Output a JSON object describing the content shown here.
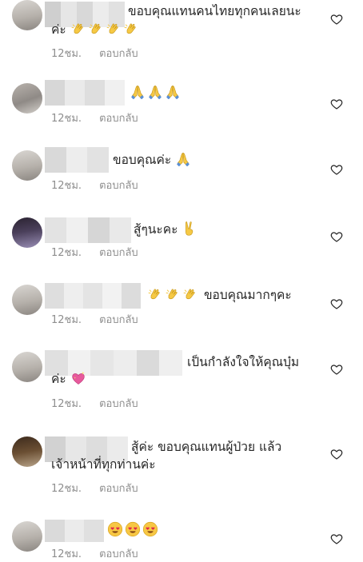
{
  "comments": [
    {
      "text_lines": [
        "ขอบคุณแทนคนไทยทุกคนเลยนะ",
        "ค่ะ"
      ],
      "emoji": "clapping-hands",
      "emoji_count": 4,
      "time": "12ชม.",
      "reply": "ตอบกลับ"
    },
    {
      "text_lines": [
        ""
      ],
      "emoji": "folded-hands",
      "emoji_count": 3,
      "time": "12ชม.",
      "reply": "ตอบกลับ"
    },
    {
      "text_lines": [
        "ขอบคุณค่ะ"
      ],
      "emoji": "folded-hands",
      "emoji_count": 1,
      "time": "12ชม.",
      "reply": "ตอบกลับ"
    },
    {
      "text_lines": [
        "สู้ๆนะคะ"
      ],
      "emoji": "victory-hand",
      "emoji_count": 1,
      "time": "12ชม.",
      "reply": "ตอบกลับ"
    },
    {
      "text_lines": [
        "ขอบคุณมากๆคะ"
      ],
      "emoji": "clapping-hands",
      "emoji_count": 3,
      "time": "12ชม.",
      "reply": "ตอบกลับ"
    },
    {
      "text_lines": [
        "เป็นกำลังใจให้คุณบุ๋ม",
        "ค่ะ"
      ],
      "emoji": "sparkling-heart",
      "emoji_count": 1,
      "time": "12ชม.",
      "reply": "ตอบกลับ"
    },
    {
      "text_lines": [
        "สู้ค่ะ ขอบคุณแทนผู้ป่วย แล้ว",
        "เจ้าหน้าที่ทุกท่านค่ะ"
      ],
      "emoji": "",
      "emoji_count": 0,
      "time": "12ชม.",
      "reply": "ตอบกลับ"
    },
    {
      "text_lines": [
        ""
      ],
      "emoji": "heart-eyes-face",
      "emoji_count": 3,
      "time": "12ชม.",
      "reply": "ตอบกลับ"
    }
  ],
  "icons": {
    "like": "heart-outline-icon"
  },
  "colors": {
    "text": "#262626",
    "meta": "#8e8e8e",
    "background": "#ffffff"
  }
}
